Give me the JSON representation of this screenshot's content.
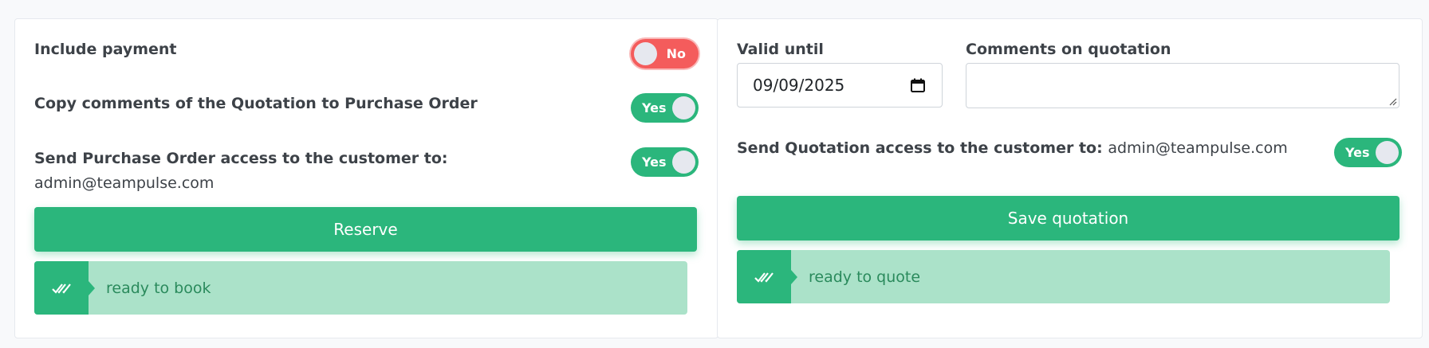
{
  "colors": {
    "accent": "#2bb67c",
    "danger": "#f45c5c",
    "status_bg": "#abe2c9",
    "status_text": "#2a8a5c"
  },
  "left": {
    "include_payment": {
      "label": "Include payment",
      "toggle": "No",
      "on": false
    },
    "copy_comments": {
      "label": "Copy comments of the Quotation to Purchase Order",
      "toggle": "Yes",
      "on": true
    },
    "send_po": {
      "label": "Send Purchase Order access to the customer to:",
      "email": "admin@teampulse.com",
      "toggle": "Yes",
      "on": true
    },
    "reserve_button": "Reserve",
    "status": {
      "icon": "double-check-icon",
      "text": "ready to book"
    }
  },
  "right": {
    "valid_until": {
      "label": "Valid until",
      "value": "09/09/2025",
      "icon": "calendar-icon"
    },
    "comments": {
      "label": "Comments on quotation",
      "value": ""
    },
    "send_quotation": {
      "label": "Send Quotation access to the customer to:",
      "email": "admin@teampulse.com",
      "toggle": "Yes",
      "on": true
    },
    "save_button": "Save quotation",
    "status": {
      "icon": "double-check-icon",
      "text": "ready to quote"
    }
  }
}
